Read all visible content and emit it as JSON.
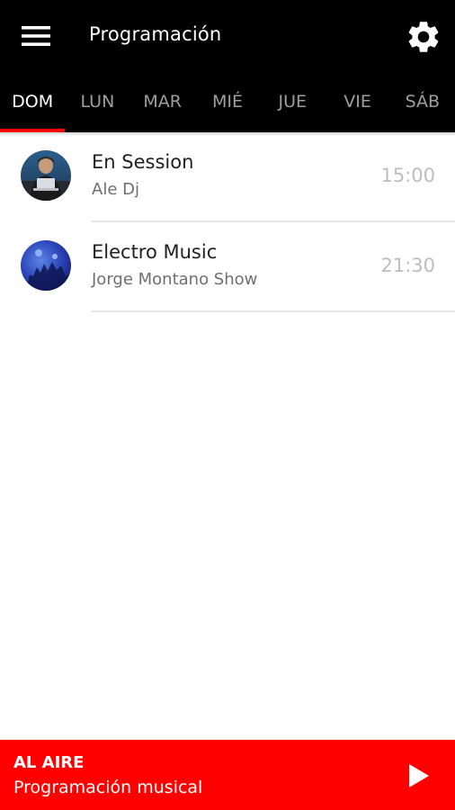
{
  "header": {
    "title": "Programación",
    "menu_icon": "menu-icon",
    "settings_icon": "gear-icon"
  },
  "tabs": [
    {
      "label": "DOM",
      "active": true
    },
    {
      "label": "LUN",
      "active": false
    },
    {
      "label": "MAR",
      "active": false
    },
    {
      "label": "MIÉ",
      "active": false
    },
    {
      "label": "JUE",
      "active": false
    },
    {
      "label": "VIE",
      "active": false
    },
    {
      "label": "SÁB",
      "active": false
    }
  ],
  "schedule": [
    {
      "title": "En Session",
      "host": "Ale Dj",
      "time": "15:00",
      "avatar_icon": "dj-avatar-icon"
    },
    {
      "title": "Electro Music",
      "host": "Jorge Montano Show",
      "time": "21:30",
      "avatar_icon": "concert-avatar-icon"
    }
  ],
  "player": {
    "label": "AL AIRE",
    "subtitle": "Programación musical",
    "play_icon": "play-icon"
  },
  "colors": {
    "topbar": "#000000",
    "accent": "#ff0000",
    "tab_inactive": "#9e9e9e",
    "time_text": "#bdbdbd"
  }
}
